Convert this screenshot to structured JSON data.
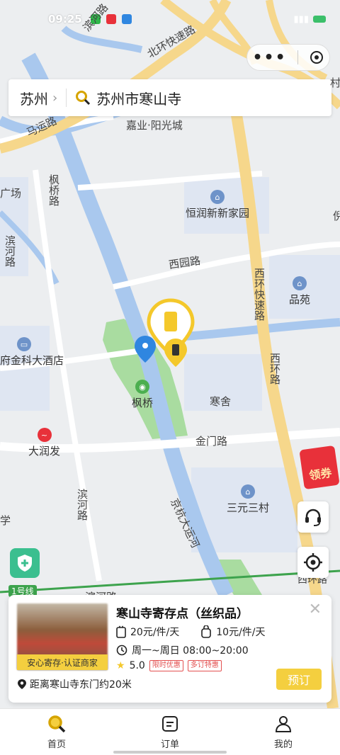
{
  "status": {
    "time": "09:25"
  },
  "search": {
    "city": "苏州",
    "query": "苏州市寒山寺"
  },
  "map_labels": {
    "road_binhe_top": "滨河路",
    "beihuan": "北环快速路",
    "mayun": "马运路",
    "jiaye": "嘉业·阳光城",
    "fengqiao_road": "枫桥路",
    "guangchang": "广场",
    "hengrun": "恒润新新家园",
    "binhe_left": "滨河路",
    "xiyuan": "西园路",
    "xihuan_express": "西环快速路",
    "pinyuan": "品苑",
    "hotel": "府金科大酒店",
    "fengqiao": "枫桥",
    "hanshe": "寒舍",
    "xihuan_road": "西环路",
    "darunfa": "大润发",
    "jinmen": "金门路",
    "binhe_mid": "滨河路",
    "jinghang": "京杭大运河",
    "sanyuan": "三元三村",
    "xue": "学",
    "line1": "1号线",
    "binhe_bottom": "滨河路",
    "xihuan_bottom": "西环路",
    "cun": "村",
    "ni": "倪"
  },
  "coupon": {
    "label": "领券"
  },
  "card": {
    "badge": "安心寄存·认证商家",
    "title": "寒山寺寄存点（丝织品）",
    "price_small": "20元/件/天",
    "price_bag": "10元/件/天",
    "hours": "周一~周日 08:00~20:00",
    "rating": "5.0",
    "tag1": "限时优惠",
    "tag2": "多订特惠",
    "distance": "距离寒山寺东门约20米",
    "book": "预订"
  },
  "tabs": [
    {
      "label": "首页",
      "icon": "search-icon"
    },
    {
      "label": "订单",
      "icon": "order-icon"
    },
    {
      "label": "我的",
      "icon": "user-icon"
    }
  ]
}
